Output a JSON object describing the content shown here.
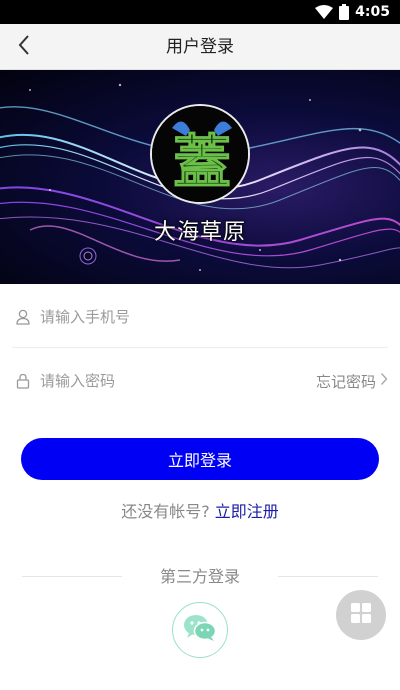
{
  "status_bar": {
    "time": "4:05"
  },
  "nav": {
    "title": "用户登录",
    "back_icon": "chevron-left-icon"
  },
  "banner": {
    "brand_name": "大海草原",
    "logo_glyph": "蓋"
  },
  "form": {
    "phone_placeholder": "请输入手机号",
    "password_placeholder": "请输入密码",
    "forgot_label": "忘记密码"
  },
  "login_button": {
    "label": "立即登录",
    "color": "#0000f5"
  },
  "register": {
    "prompt": "还没有帐号?",
    "link_label": "立即注册"
  },
  "third_party": {
    "title": "第三方登录",
    "wechat_icon": "wechat-icon"
  },
  "floating": {
    "icon": "grid-icon"
  }
}
